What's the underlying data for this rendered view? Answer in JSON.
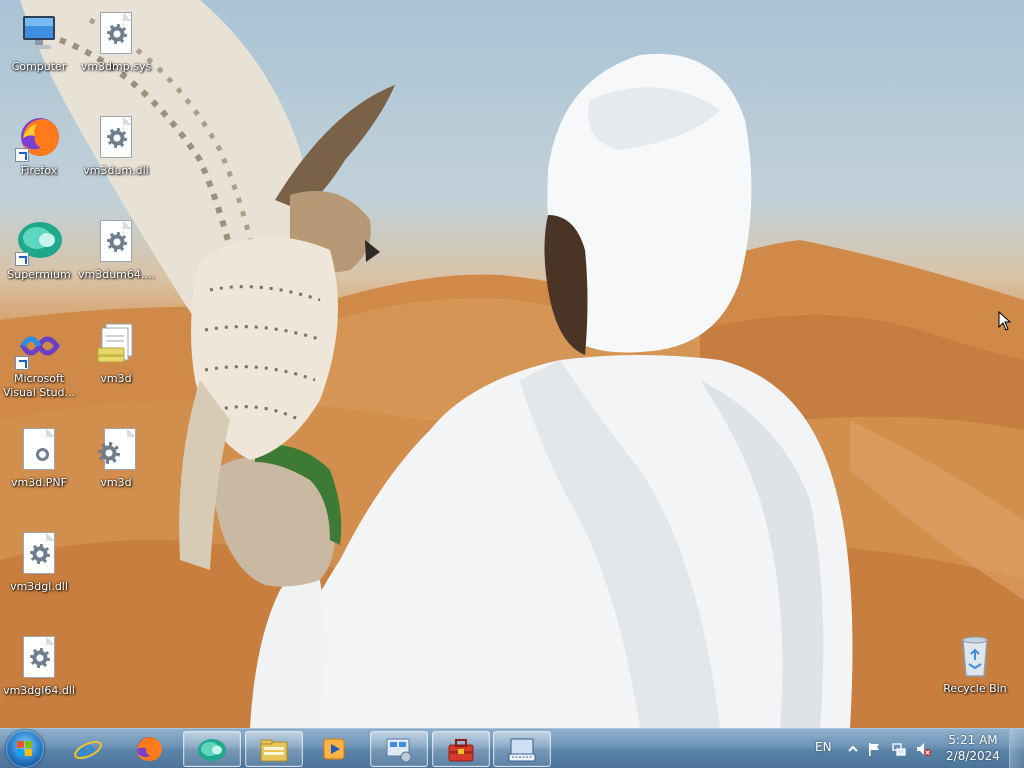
{
  "desktop": {
    "icons": [
      {
        "label": "Computer",
        "type": "computer-icon"
      },
      {
        "label": "vm3dmp.sys",
        "type": "system-file-icon"
      },
      {
        "label": "Firefox",
        "type": "firefox-icon"
      },
      {
        "label": "vm3dum.dll",
        "type": "dll-file-icon"
      },
      {
        "label": "Supermium",
        "type": "supermium-icon"
      },
      {
        "label": "vm3dum64....",
        "type": "dll-file-icon"
      },
      {
        "label": "Microsoft Visual Stud...",
        "type": "visual-studio-icon"
      },
      {
        "label": "vm3d",
        "type": "setup-info-icon"
      },
      {
        "label": "vm3d.PNF",
        "type": "pnf-file-icon"
      },
      {
        "label": "vm3d",
        "type": "catalog-file-icon"
      },
      {
        "label": "vm3dgl.dll",
        "type": "dll-file-icon"
      },
      {
        "label": "vm3dgl64.dll",
        "type": "dll-file-icon"
      },
      {
        "label": "Recycle Bin",
        "type": "recycle-bin-icon"
      }
    ]
  },
  "taskbar": {
    "pinned": [
      {
        "name": "internet-explorer",
        "icon": "internet-explorer-icon"
      },
      {
        "name": "firefox",
        "icon": "firefox-icon"
      },
      {
        "name": "supermium",
        "icon": "supermium-icon"
      },
      {
        "name": "windows-explorer",
        "icon": "folder-icon"
      },
      {
        "name": "media-player",
        "icon": "media-player-icon"
      },
      {
        "name": "control-panel-devices",
        "icon": "devices-icon"
      },
      {
        "name": "toolbox",
        "icon": "toolbox-icon"
      },
      {
        "name": "on-screen-keyboard",
        "icon": "keyboard-icon"
      }
    ],
    "language": "EN",
    "time": "5:21 AM",
    "date": "2/8/2024"
  },
  "colors": {
    "taskbar_top": "#8fb0cc",
    "taskbar_bottom": "#4d7599",
    "label_text": "#ffffff",
    "start_orb": "#2f86d2"
  }
}
